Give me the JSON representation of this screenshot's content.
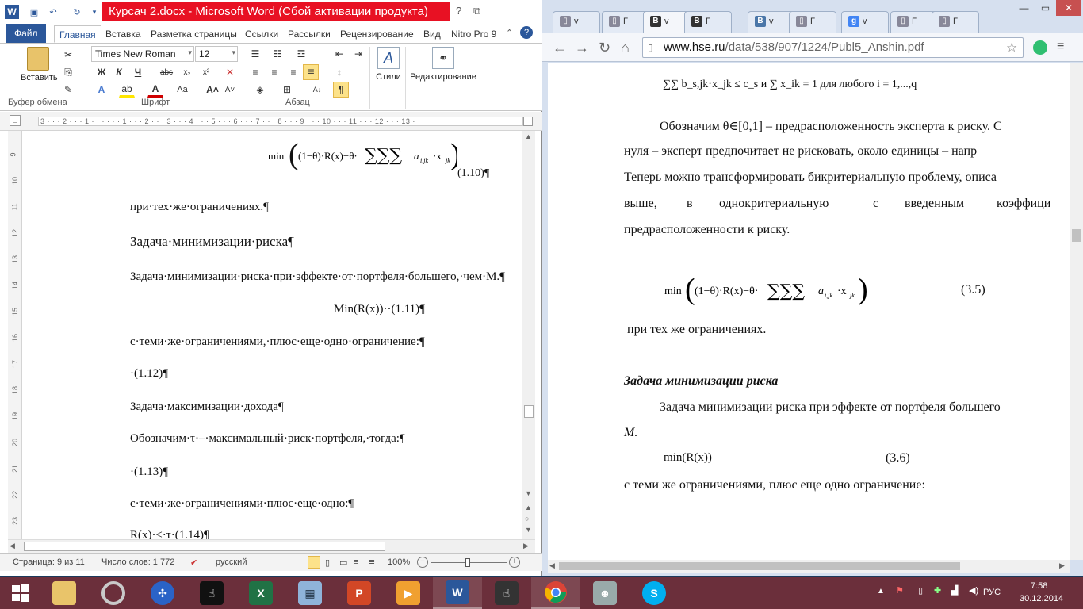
{
  "word": {
    "title": "Курсач 2.docx - Microsoft Word (Сбой активации продукта)",
    "tabs": [
      "Файл",
      "Главная",
      "Вставка",
      "Разметка страницы",
      "Ссылки",
      "Рассылки",
      "Рецензирование",
      "Вид",
      "Nitro Pro 9"
    ],
    "font_name": "Times New Roman",
    "font_size": "12",
    "groups": [
      "Буфер обмена",
      "Шрифт",
      "Абзац"
    ],
    "paste_label": "Вставить",
    "styles_label": "Стили",
    "editing_label": "Редактирование",
    "ruler_text": "3 · · · 2 · · · 1 · · · · · · 1 · · · 2 · · · 3 · · · 4 · · · 5 · · · 6 · · · 7 · · · 8 · · · 9 · · · 10 · · · 11 · · · 12 · · · 13 ·",
    "vruler_nums": [
      "9",
      "10",
      "11",
      "12",
      "13",
      "14",
      "15",
      "16",
      "17",
      "18",
      "19",
      "20",
      "21",
      "22",
      "23"
    ],
    "doc": {
      "eq_1_10": "min((1−θ)·R(x)−θ·∑∑∑ a_i,jk·x_jk)",
      "eq_1_10_num": "(1.10)¶",
      "l1": "при·тех·же·ограничениях.¶",
      "h1": "Задача·минимизации·риска¶",
      "l2": "Задача·минимизации·риска·при·эффекте·от·портфеля·большего,·чем·М.¶",
      "l3": "Min(R(x))··(1.11)¶",
      "l4": "с·теми·же·ограничениями,·плюс·еще·одно·ограничение:¶",
      "l5": "·(1.12)¶",
      "l6": "Задача·максимизации·дохода¶",
      "l7": "Обозначим·τ·–·максимальный·риск·портфеля,·тогда:¶",
      "l8": "·(1.13)¶",
      "l9": "с·теми·же·ограничениями·плюс·еще·одно:¶",
      "l10": "R(x)·≤·τ·(1.14)¶"
    },
    "status": {
      "page": "Страница: 9 из 11",
      "words": "Число слов: 1 772",
      "lang": "русский",
      "zoom": "100%"
    }
  },
  "chrome": {
    "tabs": [
      "v",
      "Г",
      "v",
      "Г",
      "v",
      "Г",
      "v",
      "Г",
      "Г"
    ],
    "url_host": "www.hse.ru",
    "url_path": "/data/538/907/1224/Publ5_Anshin.pdf",
    "pdf": {
      "eq_top": "∑∑ b_s,jk·x_jk ≤ c_s  и  ∑ x_ik = 1  для любого i = 1,...,q",
      "p1": "Обозначим θ∈[0,1] – предрасположенность эксперта к риску. С",
      "p2": "нуля – эксперт предпочитает не рисковать, около единицы – напр",
      "p3": "Теперь можно трансформировать бикритериальную проблему, описа",
      "p4a": "выше,",
      "p4b": "в",
      "p4c": "однокритериальную",
      "p4d": "с",
      "p4e": "введенным",
      "p4f": "коэффици",
      "p5": "предрасположенности к риску.",
      "eq_3_5": "min((1−θ)·R(x)−θ·∑∑∑ a_i,jk·x_jk)",
      "eq_3_5_num": "(3.5)",
      "p6": "при тех же ограничениях.",
      "h": "Задача минимизации риска",
      "p7": "Задача минимизации риска при эффекте от портфеля большего",
      "p8": "M.",
      "eq_3_6": "min(R(x))",
      "eq_3_6_num": "(3.6)",
      "p9": "с теми же ограничениями, плюс еще одно ограничение:"
    }
  },
  "taskbar": {
    "lang": "РУС",
    "time": "7:58",
    "date": "30.12.2014"
  },
  "colors": {
    "word_blue": "#2b579a",
    "title_red": "#e81123",
    "taskbar": "#6b2f3b"
  }
}
